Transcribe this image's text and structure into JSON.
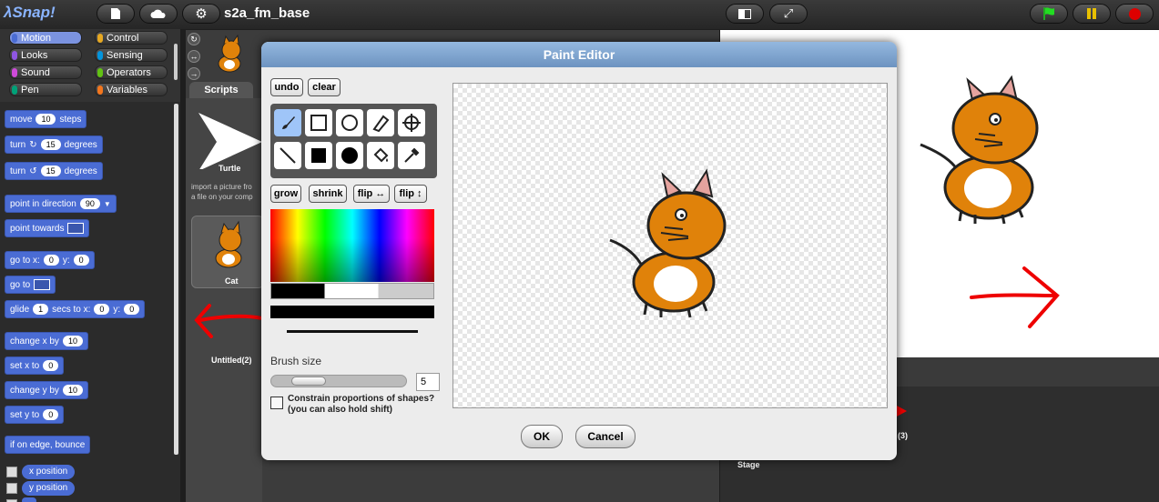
{
  "app": {
    "logo": "λSnap!",
    "project_title": "s2a_fm_base"
  },
  "categories": [
    {
      "label": "Motion",
      "color": "#4a6cd4",
      "selected": true
    },
    {
      "label": "Control",
      "color": "#e6a822"
    },
    {
      "label": "Looks",
      "color": "#8f56e3"
    },
    {
      "label": "Sensing",
      "color": "#0494dc"
    },
    {
      "label": "Sound",
      "color": "#cf4ad9"
    },
    {
      "label": "Operators",
      "color": "#62c213"
    },
    {
      "label": "Pen",
      "color": "#00a178"
    },
    {
      "label": "Variables",
      "color": "#f3761d"
    }
  ],
  "blocks": {
    "move": {
      "pre": "move",
      "val": "10",
      "post": "steps"
    },
    "turn_cw": {
      "pre": "turn",
      "val": "15",
      "post": "degrees"
    },
    "turn_ccw": {
      "pre": "turn",
      "val": "15",
      "post": "degrees"
    },
    "point_dir": {
      "pre": "point in direction",
      "val": "90"
    },
    "point_towards": {
      "pre": "point towards"
    },
    "goto_xy": {
      "pre": "go to x:",
      "x": "0",
      "y_label": "y:",
      "y": "0"
    },
    "goto": {
      "pre": "go to"
    },
    "glide": {
      "pre": "glide",
      "val": "1",
      "mid": "secs to x:",
      "x": "0",
      "y_label": "y:",
      "y": "0"
    },
    "change_x": {
      "pre": "change x by",
      "val": "10"
    },
    "set_x": {
      "pre": "set x to",
      "val": "0"
    },
    "change_y": {
      "pre": "change y by",
      "val": "10"
    },
    "set_y": {
      "pre": "set y to",
      "val": "0"
    },
    "bounce": {
      "pre": "if on edge, bounce"
    },
    "x_position": "x position",
    "y_position": "y position"
  },
  "corral": {
    "scripts_tab": "Scripts",
    "turtle_label": "Turtle",
    "import_hint_1": "import a picture fro",
    "import_hint_2": "a file on your comp",
    "cat_label": "Cat",
    "untitled_label": "Untitled(2)",
    "stage_label": "Stage",
    "count_label": "(3)"
  },
  "paint_editor": {
    "title": "Paint Editor",
    "undo": "undo",
    "clear": "clear",
    "grow": "grow",
    "shrink": "shrink",
    "flip_h": "flip ↔",
    "flip_v": "flip ↕",
    "brush_size_label": "Brush size",
    "brush_size_value": "5",
    "constrain_line1": "Constrain proportions of shapes?",
    "constrain_line2": "(you can also hold shift)",
    "ok": "OK",
    "cancel": "Cancel"
  }
}
